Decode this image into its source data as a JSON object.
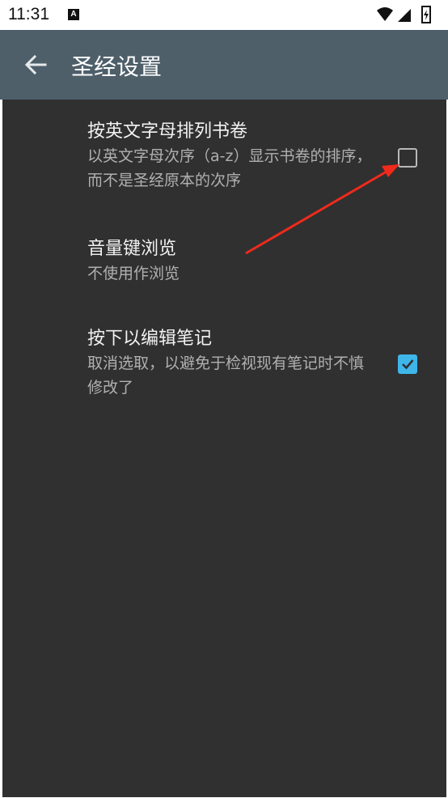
{
  "status_bar": {
    "time": "11:31",
    "notification_icon": "A",
    "icons": [
      "wifi-icon",
      "signal-icon",
      "battery-charging-icon"
    ]
  },
  "app_bar": {
    "title": "圣经设置",
    "back_icon": "arrow-left-icon",
    "background": "#4e5f6a"
  },
  "preferences": [
    {
      "title": "按英文字母排列书卷",
      "summary": "以英文字母次序（a-z）显示书卷的排序，而不是圣经原本的次序",
      "checkbox": true,
      "checked": false
    },
    {
      "title": "音量键浏览",
      "summary": "不使用作浏览",
      "checkbox": false
    },
    {
      "title": "按下以编辑笔记",
      "summary": "取消选取，以避免于检视现有笔记时不慎修改了",
      "checkbox": true,
      "checked": true
    }
  ],
  "colors": {
    "content_background": "#303030",
    "accent": "#3fb6ea",
    "annotation_arrow": "#f02a1c"
  }
}
